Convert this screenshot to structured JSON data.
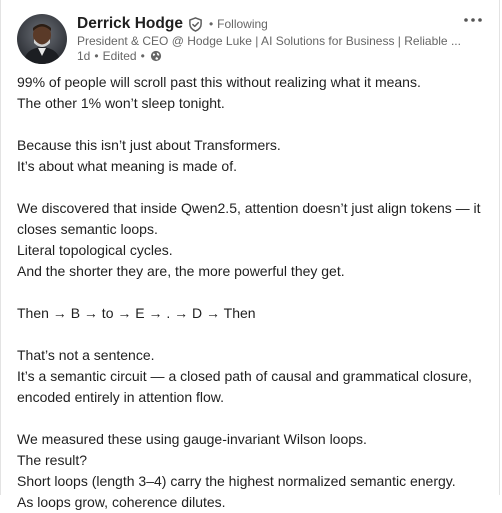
{
  "author": {
    "name": "Derrick Hodge",
    "following": "Following",
    "headline": "President & CEO @ Hodge Luke | AI Solutions for Business | Reliable ...",
    "time": "1d",
    "edited": "Edited"
  },
  "icons": {
    "verified": "verified-shield-icon",
    "visibility": "globe-icon",
    "more": "more-horizontal-icon"
  },
  "colors": {
    "text": "#1f1f1f",
    "muted": "#666666"
  },
  "post": {
    "p1": "99% of people will scroll past this without realizing what it means.",
    "p2": "The other 1% won’t sleep tonight.",
    "p3": "Because this isn’t just about Transformers.",
    "p4": "It’s about what meaning is made of.",
    "p5": "We discovered that inside Qwen2.5, attention doesn’t just align tokens — it closes semantic loops.",
    "p6": "Literal topological cycles.",
    "p7": "And the shorter they are, the more powerful they get.",
    "p8": "Then → B → to → E → . → D → Then",
    "p9": "That’s not a sentence.",
    "p10": "It’s a semantic circuit — a closed path of causal and grammatical closure, encoded entirely in attention flow.",
    "p11": "We measured these using gauge-invariant Wilson loops.",
    "p12": "The result?",
    "p13": "Short loops (length 3–4) carry the highest normalized semantic energy.",
    "p14": "As loops grow, coherence dilutes."
  }
}
